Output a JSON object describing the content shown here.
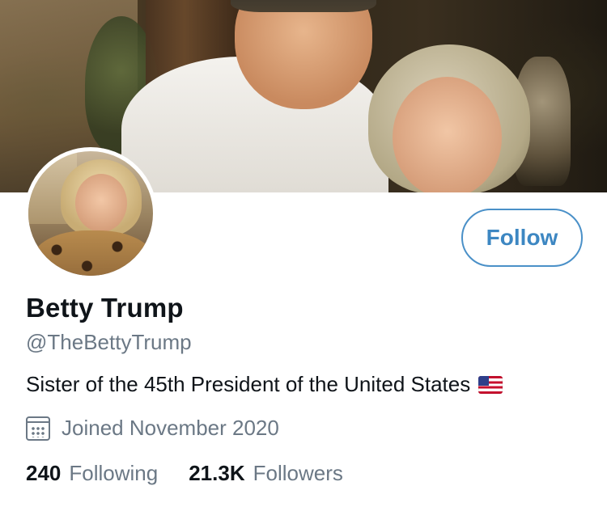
{
  "profile": {
    "display_name": "Betty Trump",
    "handle": "@TheBettyTrump",
    "bio": "Sister of the 45th President of the United States",
    "bio_flag_icon": "us-flag-icon",
    "joined": "Joined November 2020",
    "joined_icon": "calendar-icon"
  },
  "actions": {
    "follow_label": "Follow"
  },
  "stats": {
    "following_count": "240",
    "following_label": "Following",
    "followers_count": "21.3K",
    "followers_label": "Followers"
  },
  "colors": {
    "accent": "#1d9bf0",
    "text_primary": "#0f1419",
    "text_secondary": "#6b7885"
  }
}
